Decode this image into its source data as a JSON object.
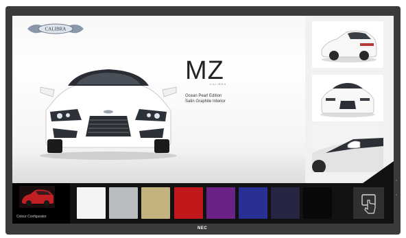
{
  "brand": {
    "logo_text": "CALIBRA",
    "bezel_label": "NEC"
  },
  "hero": {
    "model": "MZ",
    "model_sub": "CALIBRA",
    "edition_line1": "Ocean Pearl Edition",
    "edition_line2": "Satin Graphite Interior"
  },
  "thumbnails": [
    {
      "name": "rear-three-quarter-view"
    },
    {
      "name": "front-view"
    },
    {
      "name": "side-mirror-detail"
    }
  ],
  "configurator": {
    "label": "Colour Configurator"
  },
  "swatches": [
    {
      "name": "pearl-white",
      "color": "#f4f4f4"
    },
    {
      "name": "silver",
      "color": "#b9bcc1"
    },
    {
      "name": "champagne-gold",
      "color": "#c3b37e"
    },
    {
      "name": "red",
      "color": "#c1191b"
    },
    {
      "name": "purple",
      "color": "#6b2287"
    },
    {
      "name": "blue",
      "color": "#2a2f93"
    },
    {
      "name": "midnight-blue",
      "color": "#262443"
    },
    {
      "name": "black",
      "color": "#080808"
    }
  ],
  "touch_icon": "touch-hand-icon",
  "colors": {
    "bezel": "#3b3b3b",
    "tray": "#121212",
    "accent": "#b7c7da"
  }
}
